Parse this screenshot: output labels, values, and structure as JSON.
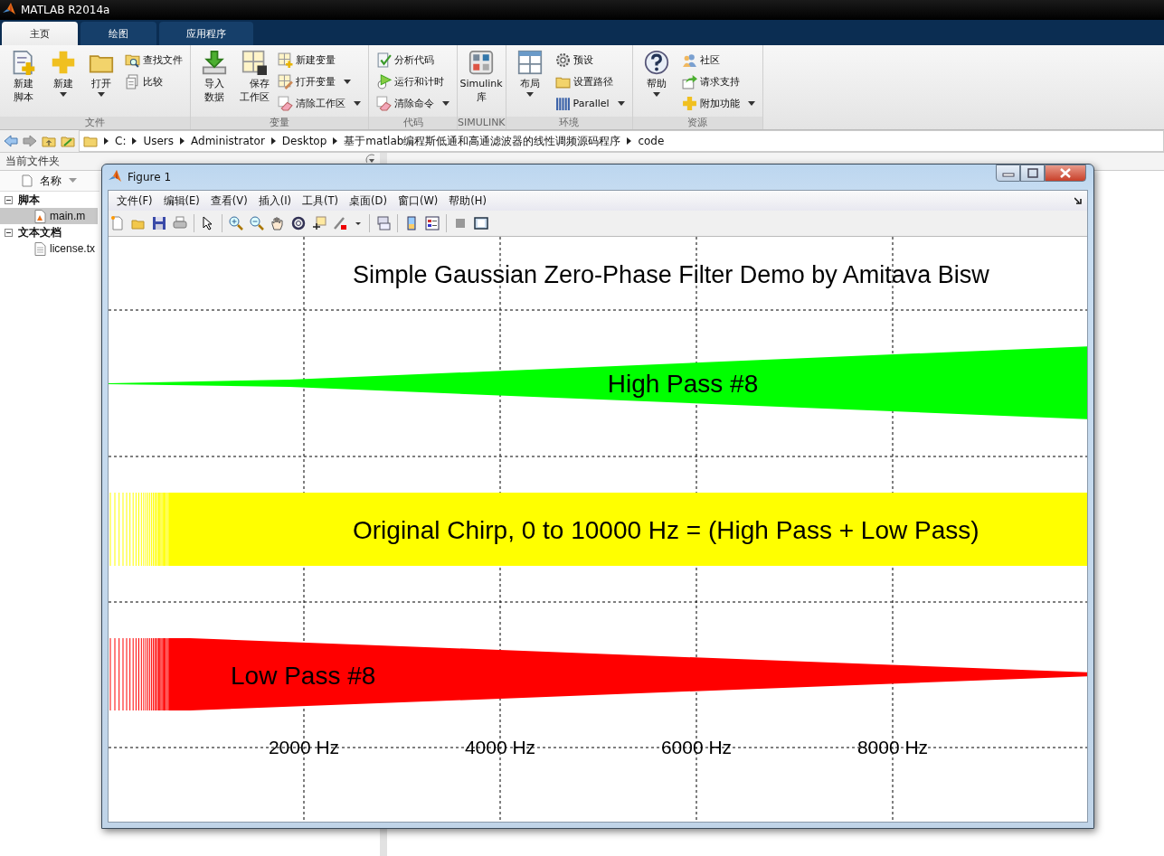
{
  "window": {
    "title": "MATLAB R2014a"
  },
  "tabs": [
    {
      "label": "主页",
      "selected": true
    },
    {
      "label": "绘图",
      "selected": false
    },
    {
      "label": "应用程序",
      "selected": false
    }
  ],
  "toolstrip": {
    "groups": [
      {
        "title": "文件",
        "items": [
          {
            "label": "新建脚本",
            "kind": "large",
            "dropdown": false
          },
          {
            "label": "新建",
            "kind": "large",
            "dropdown": true
          },
          {
            "label": "打开",
            "kind": "large",
            "dropdown": true
          },
          {
            "label": "查找文件",
            "kind": "small",
            "dropdown": false
          },
          {
            "label": "比较",
            "kind": "small",
            "dropdown": false
          }
        ]
      },
      {
        "title": "变量",
        "items": [
          {
            "label": "导入数据",
            "kind": "large",
            "dropdown": false
          },
          {
            "label": "保存工作区",
            "kind": "large",
            "dropdown": false
          },
          {
            "label": "新建变量",
            "kind": "small",
            "dropdown": false
          },
          {
            "label": "打开变量",
            "kind": "small",
            "dropdown": true
          },
          {
            "label": "清除工作区",
            "kind": "small",
            "dropdown": true
          }
        ]
      },
      {
        "title": "代码",
        "items": [
          {
            "label": "分析代码",
            "kind": "small",
            "dropdown": false
          },
          {
            "label": "运行和计时",
            "kind": "small",
            "dropdown": false
          },
          {
            "label": "清除命令",
            "kind": "small",
            "dropdown": true
          }
        ]
      },
      {
        "title": "SIMULINK",
        "items": [
          {
            "label": "Simulink 库",
            "kind": "large",
            "dropdown": false
          }
        ]
      },
      {
        "title": "环境",
        "items": [
          {
            "label": "布局",
            "kind": "large",
            "dropdown": true
          },
          {
            "label": "预设",
            "kind": "small",
            "dropdown": false
          },
          {
            "label": "设置路径",
            "kind": "small",
            "dropdown": false
          },
          {
            "label": "Parallel",
            "kind": "small",
            "dropdown": true
          }
        ]
      },
      {
        "title": "资源",
        "items": [
          {
            "label": "帮助",
            "kind": "large",
            "dropdown": true
          },
          {
            "label": "社区",
            "kind": "small",
            "dropdown": false
          },
          {
            "label": "请求支持",
            "kind": "small",
            "dropdown": false
          },
          {
            "label": "附加功能",
            "kind": "small",
            "dropdown": true
          }
        ]
      }
    ]
  },
  "address_bar": {
    "path": [
      "C:",
      "Users",
      "Administrator",
      "Desktop",
      "基于matlab编程斯低通和高通滤波器的线性调频源码程序",
      "code"
    ]
  },
  "current_folder": {
    "title": "当前文件夹",
    "column": "名称",
    "tree": [
      {
        "label": "脚本",
        "expanded": true,
        "selected": false,
        "children": [
          {
            "label": "main.m",
            "selected": true
          }
        ]
      },
      {
        "label": "文本文档",
        "expanded": true,
        "selected": false,
        "children": [
          {
            "label": "license.tx",
            "selected": false
          }
        ]
      }
    ]
  },
  "figure": {
    "title": "Figure 1",
    "menu": [
      "文件(F)",
      "编辑(E)",
      "查看(V)",
      "插入(I)",
      "工具(T)",
      "桌面(D)",
      "窗口(W)",
      "帮助(H)"
    ],
    "plot": {
      "title": "Simple Gaussian Zero-Phase Filter Demo by Amitava Bisw",
      "signals": [
        {
          "label": "High Pass #8",
          "kind": "highpass",
          "color": "#00ff00"
        },
        {
          "label": "Original Chirp, 0 to 10000 Hz = (High Pass + Low Pass)",
          "kind": "original",
          "color": "#ffff00"
        },
        {
          "label": "Low Pass #8",
          "kind": "lowpass",
          "color": "#ff0000"
        }
      ],
      "tick_labels": [
        "2000 Hz",
        "4000 Hz",
        "6000 Hz",
        "8000 Hz"
      ]
    }
  }
}
